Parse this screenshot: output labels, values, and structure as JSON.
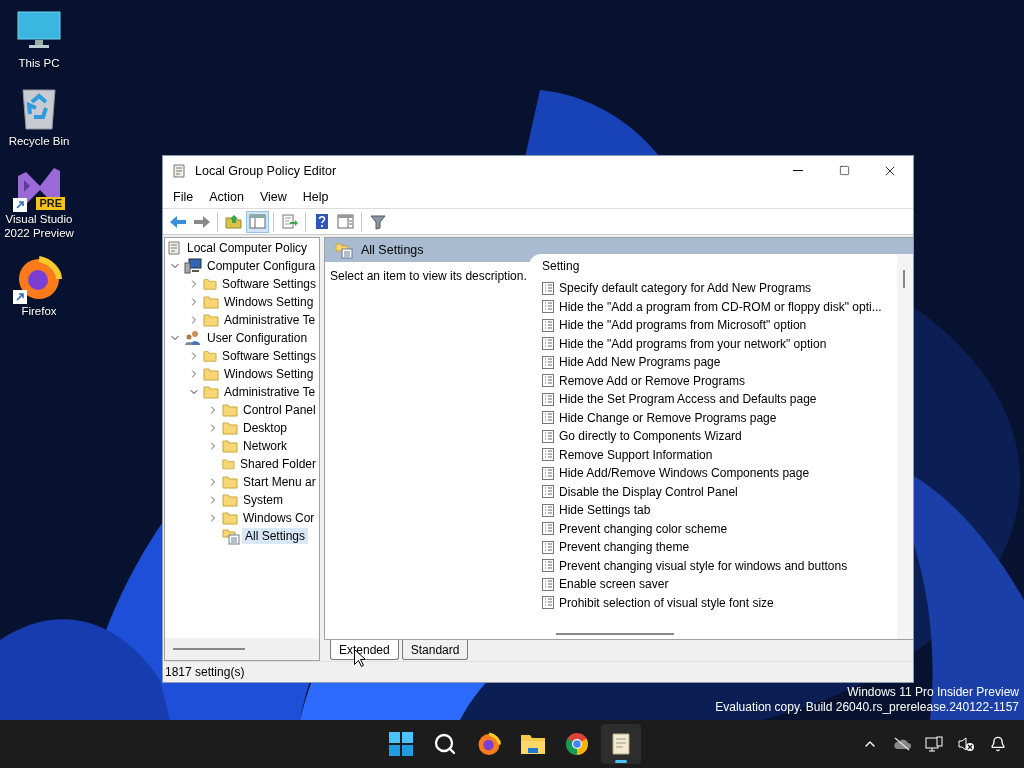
{
  "desktop_icons": [
    {
      "kind": "pc",
      "label": "This PC"
    },
    {
      "kind": "bin",
      "label": "Recycle Bin"
    },
    {
      "kind": "vs",
      "label": "Visual Studio 2022 Preview",
      "badge": "PRE",
      "shortcut": true
    },
    {
      "kind": "firefox",
      "label": "Firefox",
      "shortcut": true
    }
  ],
  "window": {
    "title": "Local Group Policy Editor"
  },
  "menu": [
    "File",
    "Action",
    "View",
    "Help"
  ],
  "toolbar": [
    {
      "kind": "back",
      "selected": false
    },
    {
      "kind": "forward",
      "selected": false
    },
    {
      "kind": "sep"
    },
    {
      "kind": "up",
      "selected": false
    },
    {
      "kind": "tree",
      "selected": true
    },
    {
      "kind": "sep"
    },
    {
      "kind": "export",
      "selected": false
    },
    {
      "kind": "sep"
    },
    {
      "kind": "help",
      "selected": false
    },
    {
      "kind": "pane",
      "selected": false
    },
    {
      "kind": "sep"
    },
    {
      "kind": "filter",
      "selected": false
    }
  ],
  "tree": [
    {
      "label": "Local Computer Policy",
      "kind": "policy",
      "selected": false,
      "children": [
        {
          "label": "Computer Configura",
          "kind": "computer",
          "expandable": true,
          "expanded": true,
          "selected": false,
          "children": [
            {
              "label": "Software Settings",
              "kind": "folder",
              "expandable": true,
              "expanded": false,
              "selected": false
            },
            {
              "label": "Windows Setting",
              "kind": "folder",
              "expandable": true,
              "expanded": false,
              "selected": false
            },
            {
              "label": "Administrative Te",
              "kind": "folder",
              "expandable": true,
              "expanded": false,
              "selected": false
            }
          ]
        },
        {
          "label": "User Configuration",
          "kind": "user",
          "expandable": true,
          "expanded": true,
          "selected": false,
          "children": [
            {
              "label": "Software Settings",
              "kind": "folder",
              "expandable": true,
              "expanded": false,
              "selected": false
            },
            {
              "label": "Windows Setting",
              "kind": "folder",
              "expandable": true,
              "expanded": false,
              "selected": false
            },
            {
              "label": "Administrative Te",
              "kind": "folder",
              "expandable": true,
              "expanded": true,
              "selected": false,
              "children": [
                {
                  "label": "Control Panel",
                  "kind": "folder",
                  "expandable": true,
                  "expanded": false,
                  "selected": false
                },
                {
                  "label": "Desktop",
                  "kind": "folder",
                  "expandable": true,
                  "expanded": false,
                  "selected": false
                },
                {
                  "label": "Network",
                  "kind": "folder",
                  "expandable": true,
                  "expanded": false,
                  "selected": false
                },
                {
                  "label": "Shared Folder",
                  "kind": "folder",
                  "expandable": false,
                  "expanded": false,
                  "selected": false
                },
                {
                  "label": "Start Menu ar",
                  "kind": "folder",
                  "expandable": true,
                  "expanded": false,
                  "selected": false
                },
                {
                  "label": "System",
                  "kind": "folder",
                  "expandable": true,
                  "expanded": false,
                  "selected": false
                },
                {
                  "label": "Windows Cor",
                  "kind": "folder",
                  "expandable": true,
                  "expanded": false,
                  "selected": false
                },
                {
                  "label": "All Settings",
                  "kind": "settings",
                  "expandable": false,
                  "expanded": false,
                  "selected": true
                }
              ]
            }
          ]
        }
      ]
    }
  ],
  "details": {
    "header": "All Settings",
    "description": "Select an item to view its description.",
    "column": "Setting",
    "rows": [
      "Specify default category for Add New Programs",
      "Hide the \"Add a program from CD-ROM or floppy disk\" opti...",
      "Hide the \"Add programs from Microsoft\" option",
      "Hide the \"Add programs from your network\" option",
      "Hide Add New Programs page",
      "Remove Add or Remove Programs",
      "Hide the Set Program Access and Defaults page",
      "Hide Change or Remove Programs page",
      "Go directly to Components Wizard",
      "Remove Support Information",
      "Hide Add/Remove Windows Components page",
      "Disable the Display Control Panel",
      "Hide Settings tab",
      "Prevent changing color scheme",
      "Prevent changing theme",
      "Prevent changing visual style for windows and buttons",
      "Enable screen saver",
      "Prohibit selection of visual style font size"
    ]
  },
  "tabs": [
    {
      "label": "Extended",
      "selected": true
    },
    {
      "label": "Standard",
      "selected": false
    }
  ],
  "status_bar": "1817 setting(s)",
  "watermark": [
    "Windows 11 Pro Insider Preview",
    "Evaluation copy. Build 26040.rs_prerelease.240122-1157"
  ],
  "taskbar": [
    {
      "kind": "start",
      "active": false
    },
    {
      "kind": "search",
      "active": false
    },
    {
      "kind": "firefox",
      "active": false
    },
    {
      "kind": "explorer",
      "active": false
    },
    {
      "kind": "chrome",
      "active": false
    },
    {
      "kind": "gpedit",
      "active": true
    }
  ],
  "tray": [
    {
      "kind": "chevron"
    },
    {
      "kind": "cloud"
    },
    {
      "kind": "network"
    },
    {
      "kind": "volume"
    },
    {
      "kind": "bell"
    }
  ]
}
